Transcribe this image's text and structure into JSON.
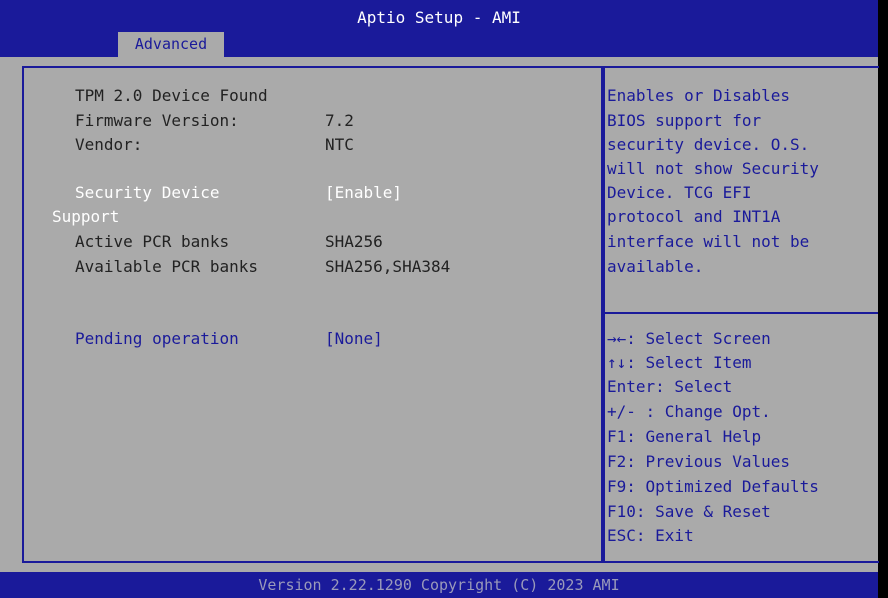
{
  "header": {
    "title": "Aptio Setup - AMI",
    "tab": "Advanced"
  },
  "main": {
    "tpm_found": "TPM 2.0 Device Found",
    "firmware_label": "Firmware Version:",
    "firmware_value": "7.2",
    "vendor_label": "Vendor:",
    "vendor_value": "NTC",
    "security_label_1": "Security Device",
    "security_label_2": "Support",
    "security_value": "[Enable]",
    "active_pcr_label": "Active PCR banks",
    "active_pcr_value": "SHA256",
    "available_pcr_label": "Available PCR banks",
    "available_pcr_value": "SHA256,SHA384",
    "pending_label": "Pending operation",
    "pending_value": "[None]"
  },
  "help": {
    "description_lines": [
      "Enables or Disables",
      "BIOS support for",
      "security device. O.S.",
      "will not show Security",
      "Device. TCG EFI",
      "protocol and INT1A",
      "interface will not be",
      "available."
    ],
    "keys": [
      "→←: Select Screen",
      "↑↓: Select Item",
      "Enter: Select",
      "+/- : Change Opt.",
      "F1: General Help",
      "F2: Previous Values",
      "F9: Optimized Defaults",
      "F10: Save & Reset",
      "ESC: Exit"
    ]
  },
  "footer": {
    "text": "Version 2.22.1290 Copyright (C) 2023 AMI"
  },
  "colors": {
    "bios_blue": "#1a1a9a",
    "panel_gray": "#aaaaaa",
    "text_white": "#ffffff"
  }
}
